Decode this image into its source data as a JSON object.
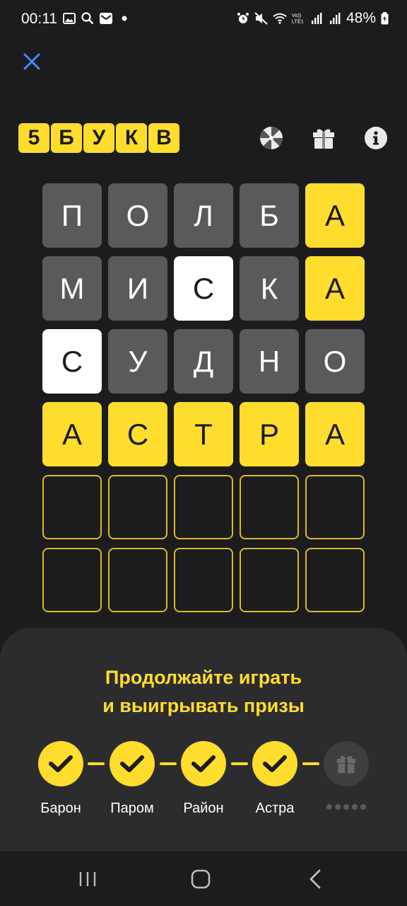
{
  "status_bar": {
    "time": "00:11",
    "battery": "48%",
    "left_icons": [
      "image-icon",
      "search-icon",
      "mail-icon",
      "dot-icon"
    ],
    "right_icons": [
      "alarm-icon",
      "mute-icon",
      "wifi-icon",
      "volte-icon",
      "signal-icon",
      "signal-icon",
      "battery-icon"
    ]
  },
  "header": {
    "logo_letters": [
      "5",
      "Б",
      "У",
      "К",
      "В"
    ],
    "icons": [
      "wheel-icon",
      "gift-icon",
      "info-icon"
    ]
  },
  "grid": {
    "rows": [
      [
        {
          "letter": "П",
          "state": "absent"
        },
        {
          "letter": "О",
          "state": "absent"
        },
        {
          "letter": "Л",
          "state": "absent"
        },
        {
          "letter": "Б",
          "state": "absent"
        },
        {
          "letter": "А",
          "state": "correct"
        }
      ],
      [
        {
          "letter": "М",
          "state": "absent"
        },
        {
          "letter": "И",
          "state": "absent"
        },
        {
          "letter": "С",
          "state": "present"
        },
        {
          "letter": "К",
          "state": "absent"
        },
        {
          "letter": "А",
          "state": "correct"
        }
      ],
      [
        {
          "letter": "С",
          "state": "present"
        },
        {
          "letter": "У",
          "state": "absent"
        },
        {
          "letter": "Д",
          "state": "absent"
        },
        {
          "letter": "Н",
          "state": "absent"
        },
        {
          "letter": "О",
          "state": "absent"
        }
      ],
      [
        {
          "letter": "А",
          "state": "correct"
        },
        {
          "letter": "С",
          "state": "correct"
        },
        {
          "letter": "Т",
          "state": "correct"
        },
        {
          "letter": "Р",
          "state": "correct"
        },
        {
          "letter": "А",
          "state": "correct"
        }
      ],
      [
        {
          "letter": "",
          "state": "empty"
        },
        {
          "letter": "",
          "state": "empty"
        },
        {
          "letter": "",
          "state": "empty"
        },
        {
          "letter": "",
          "state": "empty"
        },
        {
          "letter": "",
          "state": "empty"
        }
      ],
      [
        {
          "letter": "",
          "state": "empty"
        },
        {
          "letter": "",
          "state": "empty"
        },
        {
          "letter": "",
          "state": "empty"
        },
        {
          "letter": "",
          "state": "empty"
        },
        {
          "letter": "",
          "state": "empty"
        }
      ]
    ]
  },
  "sheet": {
    "title_line1": "Продолжайте играть",
    "title_line2": "и выигрывать призы",
    "progress": [
      {
        "label": "Барон",
        "done": true
      },
      {
        "label": "Паром",
        "done": true
      },
      {
        "label": "Район",
        "done": true
      },
      {
        "label": "Астра",
        "done": true
      },
      {
        "label": "",
        "done": false
      }
    ]
  },
  "colors": {
    "accent": "#ffdd2d",
    "background": "#1c1c1e",
    "sheet": "#2c2c2e",
    "absent": "#5a5a5c",
    "present": "#ffffff"
  }
}
